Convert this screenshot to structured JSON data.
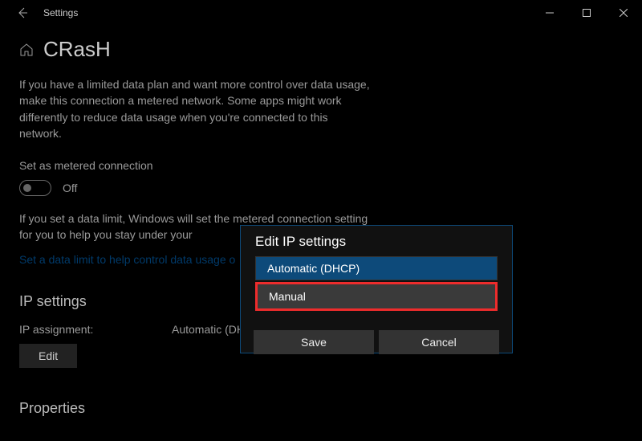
{
  "window": {
    "title": "Settings"
  },
  "page": {
    "title": "CRasH",
    "intro": "If you have a limited data plan and want more control over data usage, make this connection a metered network. Some apps might work differently to reduce data usage when you're connected to this network.",
    "metered_label": "Set as metered connection",
    "toggle_state": "Off",
    "data_limit_text": "If you set a data limit, Windows will set the metered connection setting for you to help you stay under your",
    "data_limit_link": "Set a data limit to help control data usage o"
  },
  "ip": {
    "section_title": "IP settings",
    "assignment_label": "IP assignment:",
    "assignment_value": "Automatic (DHC",
    "edit_button": "Edit"
  },
  "properties": {
    "section_title": "Properties"
  },
  "dialog": {
    "title": "Edit IP settings",
    "option_auto": "Automatic (DHCP)",
    "option_manual": "Manual",
    "save": "Save",
    "cancel": "Cancel"
  }
}
